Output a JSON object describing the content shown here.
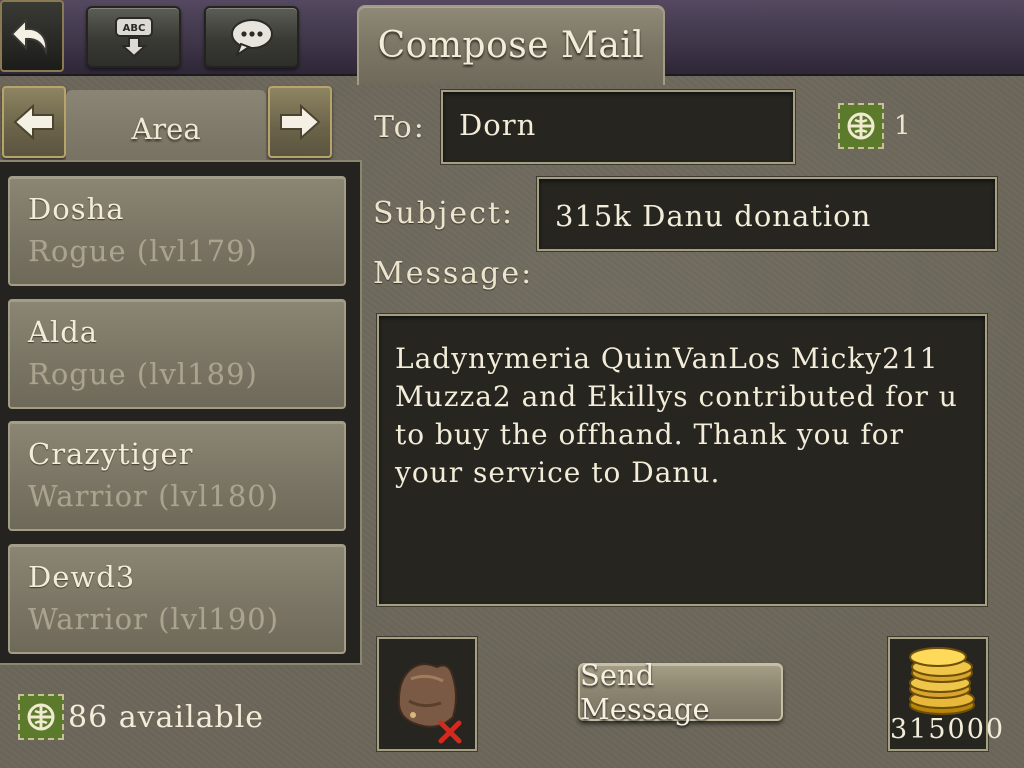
{
  "header": {
    "tab_title": "Compose Mail",
    "buttons": [
      "back-arrow-icon",
      "abc-download-icon",
      "speech-bubble-icon"
    ]
  },
  "sidebar": {
    "filter_label": "Area",
    "items": [
      {
        "name": "Dosha",
        "class": "Rogue (lvl179)"
      },
      {
        "name": "Alda",
        "class": "Rogue (lvl189)"
      },
      {
        "name": "Crazytiger",
        "class": "Warrior (lvl180)"
      },
      {
        "name": "Dewd3",
        "class": "Warrior (lvl190)"
      }
    ],
    "available_text": "86 available"
  },
  "form": {
    "to_label": "To:",
    "to_value": "Dorn",
    "stamp_count": "1",
    "subject_label": "Subject:",
    "subject_value": "315k Danu donation",
    "message_label": "Message:",
    "message_value": "Ladynymeria QuinVanLos Micky211 Muzza2 and Ekillys contributed for u to buy the offhand. Thank you for your service to Danu."
  },
  "footer": {
    "send_label": "Send Message",
    "gold_amount": "315000"
  },
  "colors": {
    "accent_green": "#5c7a2c",
    "gold": "#e8b83a",
    "remove_red": "#d42a1e"
  }
}
